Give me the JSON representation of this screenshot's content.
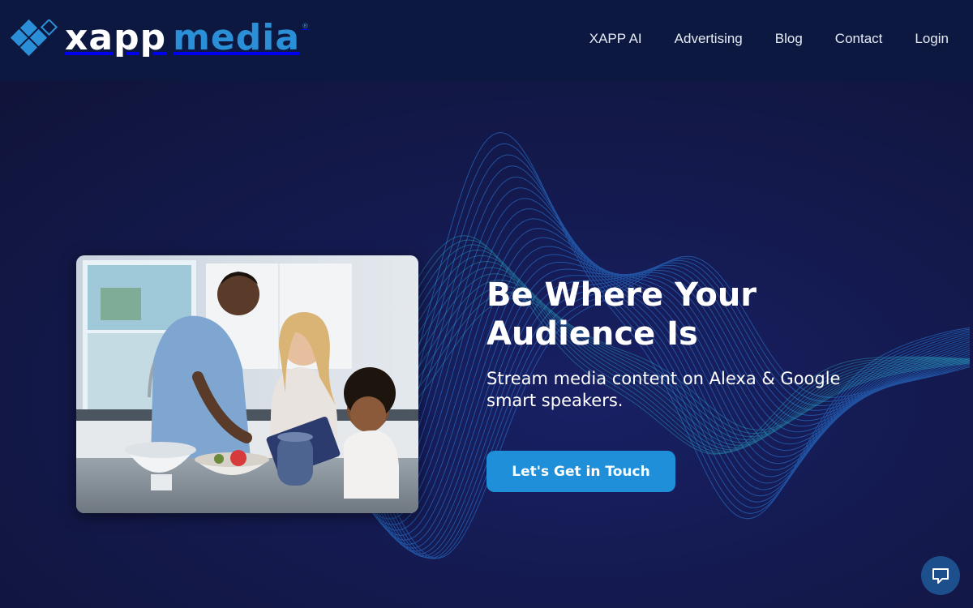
{
  "brand": {
    "logo_word_1": "xapp",
    "logo_word_2": "media",
    "trademark": "®",
    "colors": {
      "primary": "#2a8fd6",
      "header_bg": "#0c1840",
      "hero_bg": "#131a45",
      "cta": "#1e8fd8"
    }
  },
  "nav": {
    "items": [
      {
        "label": "XAPP AI"
      },
      {
        "label": "Advertising"
      },
      {
        "label": "Blog"
      },
      {
        "label": "Contact"
      },
      {
        "label": "Login"
      }
    ]
  },
  "hero": {
    "title": "Be Where Your Audience Is",
    "subtitle": "Stream media content on Alexa & Google smart speakers.",
    "cta_label": "Let's Get in Touch",
    "image_icon": "family-kitchen-smart-speaker-photo"
  },
  "chat": {
    "icon": "chat-bubble-icon"
  }
}
